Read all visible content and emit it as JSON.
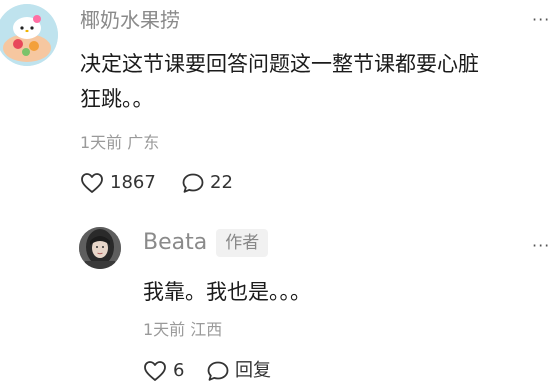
{
  "comment": {
    "username": "椰奶水果捞",
    "text_line1": "决定这节课要回答问题这一整节课都要心脏",
    "text_line2": "狂跳。。",
    "time": "1天前",
    "location": "广东",
    "likes": "1867",
    "replies": "22",
    "more_label": "···"
  },
  "reply": {
    "username": "Beata",
    "badge": "作者",
    "text": "我靠。我也是。。。",
    "time": "1天前",
    "location": "江西",
    "likes": "6",
    "reply_label": "回复",
    "more_label": "···"
  }
}
